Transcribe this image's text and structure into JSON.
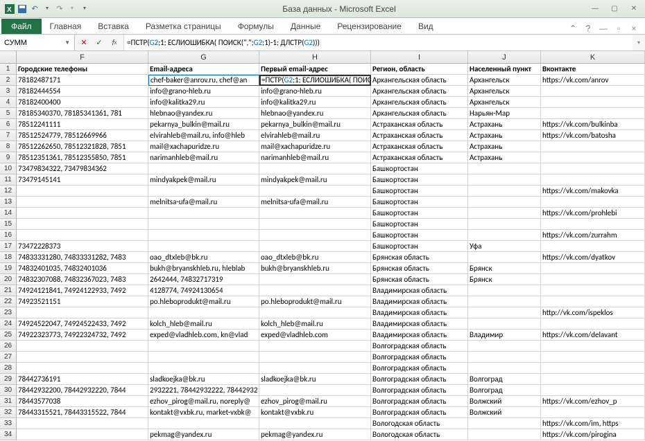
{
  "title": "База данных - Microsoft Excel",
  "ribbon": {
    "file": "Файл",
    "tabs": [
      "Главная",
      "Вставка",
      "Разметка страницы",
      "Формулы",
      "Данные",
      "Рецензирование",
      "Вид"
    ]
  },
  "namebox": "СУММ",
  "formula": {
    "plain": "=ПСТР(G2;1; ЕСЛИОШИБКА( ПОИСК(\",\";G2;1)-1; ДЛСТР(G2)))",
    "parts": [
      {
        "t": "=ПСТР(",
        "c": ""
      },
      {
        "t": "G2",
        "c": "c1"
      },
      {
        "t": ";1; ЕСЛИОШИБКА( ПОИСК(\",\";",
        "c": ""
      },
      {
        "t": "G2",
        "c": "c1"
      },
      {
        "t": ";1)-1; ДЛСТР(",
        "c": ""
      },
      {
        "t": "G2",
        "c": "c1"
      },
      {
        "t": ")))",
        "c": ""
      }
    ]
  },
  "columns": [
    "F",
    "G",
    "H",
    "I",
    "J",
    "K"
  ],
  "header_row": {
    "F": "Городские телефоны",
    "G": "Email-адреса",
    "H": "Первый email-адрес",
    "I": "Регион, область",
    "J": "Населенный пункт",
    "K": "Вконтакте"
  },
  "active_cell_formula_parts": [
    {
      "t": "=ПСТР(",
      "c": ""
    },
    {
      "t": "G2",
      "c": "c1"
    },
    {
      "t": ";1; ЕСЛИОШИБКА( ПОИСК(",
      "c": ""
    },
    {
      "t": "\",\"",
      "c": "c2"
    },
    {
      "t": ";",
      "c": ""
    },
    {
      "t": "G2",
      "c": "c1"
    },
    {
      "t": ";",
      "c": ""
    },
    {
      "t": "1",
      "c": ""
    },
    {
      "t": ")-",
      "c": ""
    },
    {
      "t": "1",
      "c": ""
    },
    {
      "t": "; ДЛСТР(",
      "c": ""
    },
    {
      "t": "G2",
      "c": "c1"
    },
    {
      "t": ")))",
      "c": ""
    }
  ],
  "rows": [
    {
      "n": 2,
      "F": "78182487171",
      "G": "chef-baker@anrov.ru, chef@an",
      "H": "__FORMULA__",
      "I": "Архангельская область",
      "J": "Архангельск",
      "K": "https://vk.com/anrov"
    },
    {
      "n": 3,
      "F": "78182444554",
      "G": "info@grano-hleb.ru",
      "H": "info@grano-hleb.ru",
      "I": "Архангельская область",
      "J": "Архангельск",
      "K": ""
    },
    {
      "n": 4,
      "F": "78182400400",
      "G": "info@kalitka29.ru",
      "H": "info@kalitka29.ru",
      "I": "Архангельская область",
      "J": "Архангельск",
      "K": ""
    },
    {
      "n": 5,
      "F": "78185340370, 78185341361, 781",
      "G": "hlebnao@yandex.ru",
      "H": "hlebnao@yandex.ru",
      "I": "Архангельская область",
      "J": "Нарьян-Мар",
      "K": ""
    },
    {
      "n": 6,
      "F": "78512241111",
      "G": "pekarnya_bulkin@mail.ru",
      "H": "pekarnya_bulkin@mail.ru",
      "I": "Астраханская область",
      "J": "Астрахань",
      "K": "https://vk.com/bulkinba"
    },
    {
      "n": 7,
      "F": "78512524779, 78512669966",
      "G": "elvirahleb@mail.ru, info@hleb",
      "H": "elvirahleb@mail.ru",
      "I": "Астраханская область",
      "J": "Астрахань",
      "K": "https://vk.com/batosha"
    },
    {
      "n": 8,
      "F": "78512262650, 78512321828, 7851",
      "G": "mail@xachapuridze.ru",
      "H": "mail@xachapuridze.ru",
      "I": "Астраханская область",
      "J": "Астрахань",
      "K": ""
    },
    {
      "n": 9,
      "F": "78512351361, 78512355850, 7851",
      "G": "narimanhleb@mail.ru",
      "H": "narimanhleb@mail.ru",
      "I": "Астраханская область",
      "J": "Астрахань",
      "K": ""
    },
    {
      "n": 10,
      "F": "73479834322, 73479834362",
      "G": "",
      "H": "",
      "I": "Башкортостан",
      "J": "",
      "K": ""
    },
    {
      "n": 11,
      "F": "73479145141",
      "G": "mindyakpek@mail.ru",
      "H": "mindyakpek@mail.ru",
      "I": "Башкортостан",
      "J": "",
      "K": ""
    },
    {
      "n": 12,
      "F": "",
      "G": "",
      "H": "",
      "I": "Башкортостан",
      "J": "",
      "K": "https://vk.com/makovka"
    },
    {
      "n": 13,
      "F": "",
      "G": "melnitsa-ufa@mail.ru",
      "H": "melnitsa-ufa@mail.ru",
      "I": "Башкортостан",
      "J": "",
      "K": ""
    },
    {
      "n": 14,
      "F": "",
      "G": "",
      "H": "",
      "I": "Башкортостан",
      "J": "",
      "K": "https://vk.com/prohlebi"
    },
    {
      "n": 15,
      "F": "",
      "G": "",
      "H": "",
      "I": "Башкортостан",
      "J": "",
      "K": ""
    },
    {
      "n": 16,
      "F": "",
      "G": "",
      "H": "",
      "I": "Башкортостан",
      "J": "",
      "K": "https://vk.com/zurrahm"
    },
    {
      "n": 17,
      "F": "73472228373",
      "G": "",
      "H": "",
      "I": "Башкортостан",
      "J": "Уфа",
      "K": ""
    },
    {
      "n": 18,
      "F": "74833331280, 74833331282, 7483",
      "G": "oao_dtxleb@bk.ru",
      "H": "oao_dtxleb@bk.ru",
      "I": "Брянская область",
      "J": "",
      "K": "https://vk.com/dyatkov"
    },
    {
      "n": 19,
      "F": "74832401035, 74832401036",
      "G": "bukh@bryanskhleb.ru, hleblab",
      "H": "bukh@bryanskhleb.ru",
      "I": "Брянская область",
      "J": "Брянск",
      "K": ""
    },
    {
      "n": 20,
      "F": "74832307088, 74832367023, 7483",
      "G": "2642444, 74832717319",
      "H": "",
      "I": "Брянская область",
      "J": "Брянск",
      "K": ""
    },
    {
      "n": 21,
      "F": "74924121841, 74924122933, 7492",
      "G": "4128774, 74924130654",
      "H": "",
      "I": "Владимирская область",
      "J": "",
      "K": ""
    },
    {
      "n": 22,
      "F": "74923521151",
      "G": "po.hleboprodukt@mail.ru",
      "H": "po.hleboprodukt@mail.ru",
      "I": "Владимирская область",
      "J": "",
      "K": ""
    },
    {
      "n": 23,
      "F": "",
      "G": "",
      "H": "",
      "I": "Владимирская область",
      "J": "",
      "K": "http://vk.com/ispeklos"
    },
    {
      "n": 24,
      "F": "74924522047, 74924522433, 7492",
      "G": "kolch_hleb@mail.ru",
      "H": "kolch_hleb@mail.ru",
      "I": "Владимирская область",
      "J": "",
      "K": ""
    },
    {
      "n": 25,
      "F": "74922323773, 74922324732, 7492",
      "G": "exped@vladhleb.com, kn@vlad",
      "H": "exped@vladhleb.com",
      "I": "Владимирская область",
      "J": "Владимир",
      "K": "https://vk.com/delavant"
    },
    {
      "n": 26,
      "F": "",
      "G": "",
      "H": "",
      "I": "Волгоградская область",
      "J": "",
      "K": ""
    },
    {
      "n": 27,
      "F": "",
      "G": "",
      "H": "",
      "I": "Волгоградская область",
      "J": "",
      "K": ""
    },
    {
      "n": 28,
      "F": "",
      "G": "",
      "H": "",
      "I": "Волгоградская область",
      "J": "",
      "K": ""
    },
    {
      "n": 29,
      "F": "78442736191",
      "G": "sladkoejka@bk.ru",
      "H": "sladkoejka@bk.ru",
      "I": "Волгоградская область",
      "J": "Волгоград",
      "K": ""
    },
    {
      "n": 30,
      "F": "78442932200, 78442932220, 7844",
      "G": "2932221, 78442932222, 78442932",
      "H": "",
      "I": "Волгоградская область",
      "J": "Волгоград",
      "K": ""
    },
    {
      "n": 31,
      "F": "78443577038",
      "G": "ezhov_pirog@mail.ru, noreply@",
      "H": "ezhov_pirog@mail.ru",
      "I": "Волгоградская область",
      "J": "Волжский",
      "K": "https://vk.com/ezhov_p"
    },
    {
      "n": 32,
      "F": "78443315521, 78443315522, 7844",
      "G": "kontakt@vxbk.ru, market-vxbk@",
      "H": "kontakt@vxbk.ru",
      "I": "Волгоградская область",
      "J": "Волжский",
      "K": ""
    },
    {
      "n": 33,
      "F": "",
      "G": "",
      "H": "",
      "I": "Вологодская область",
      "J": "",
      "K": "https://vk.com/im, https"
    },
    {
      "n": 34,
      "F": "",
      "G": "pekmag@yandex.ru",
      "H": "pekmag@yandex.ru",
      "I": "Вологодская область",
      "J": "",
      "K": "https://vk.com/pirogina"
    }
  ]
}
